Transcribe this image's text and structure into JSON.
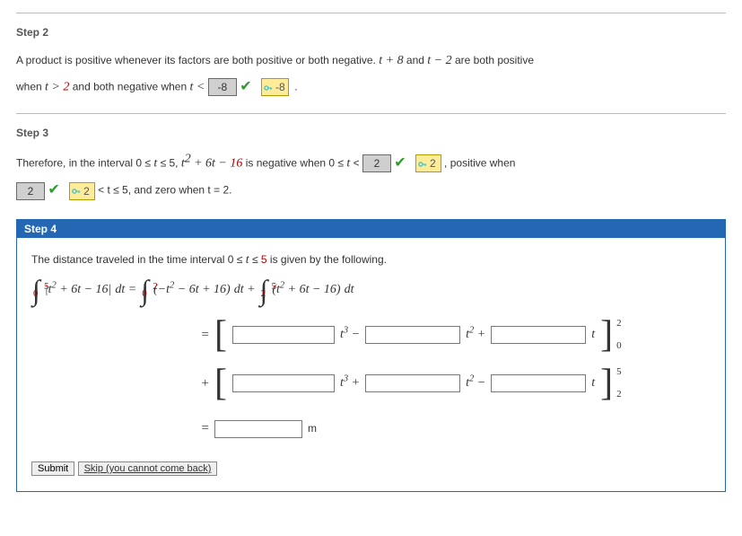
{
  "step2": {
    "heading": "Step 2",
    "text_a": "A product is positive whenever its factors are both positive or both negative. ",
    "expr1": "t + 8",
    "and": " and ",
    "expr2": "t − 2",
    "text_b": " are both positive",
    "text_c": "when  ",
    "cond1_lhs": "t > ",
    "cond1_rhs": "2",
    "text_d": "  and both negative when ",
    "cond2_lhs": "t < ",
    "ans1": "-8",
    "key1": "-8",
    "period": "."
  },
  "step3": {
    "heading": "Step 3",
    "text_a": "Therefore, in the interval  0 ≤ ",
    "tvar": "t",
    "leq5": " ≤ 5,  ",
    "poly": "t",
    "poly_rest": " + 6t − ",
    "poly_16": "16",
    "text_neg": "  is negative when  0 ≤ ",
    "lt": " < ",
    "ans2": "2",
    "key2": "2",
    "text_pos": " ,  positive when",
    "ans3": "2",
    "key3": "2",
    "tail": "  < t ≤ 5,  and zero when t = 2."
  },
  "step4": {
    "heading": "Step 4",
    "intro_a": "The distance traveled in the time interval  0 ≤ ",
    "tvar": "t",
    "intro_b": " ≤ ",
    "five": "5",
    "intro_c": "  is given by the following.",
    "int1": {
      "lb": "0",
      "ub": "5",
      "integrand_a": "|",
      "integrand_var": "t",
      "integrand_b": " + 6t − 16|",
      "dt": " dt  ="
    },
    "int2": {
      "lb": "0",
      "ub": "2",
      "pre": "(−",
      "var": "t",
      "rest": " − 6t + 16)",
      "dt": " dt  +"
    },
    "int3": {
      "lb": "2",
      "ub": "5",
      "pre": "(",
      "var": "t",
      "rest": " + 6t − 16)",
      "dt": " dt"
    },
    "row1": {
      "eq": "=",
      "t3": " t",
      "minus": " −",
      "t2": " t",
      "plus": " +",
      "t": " t",
      "lim_top": "2",
      "lim_bot": "0"
    },
    "row2": {
      "plus": "+",
      "t3": " t",
      "p": " +",
      "t2": " t",
      "m": " −",
      "t": " t",
      "lim_top": "5",
      "lim_bot": "2"
    },
    "row3": {
      "eq": "=",
      "unit": "m"
    },
    "submit": "Submit",
    "skip": "Skip (you cannot come back)"
  }
}
